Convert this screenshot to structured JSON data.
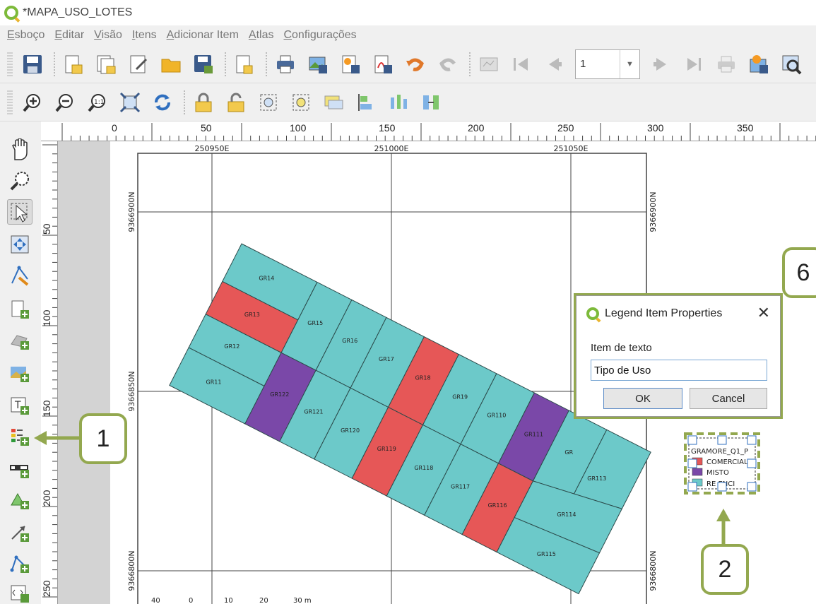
{
  "window": {
    "title": "*MAPA_USO_LOTES"
  },
  "menu": [
    "Esboço",
    "Editar",
    "Visão",
    "Itens",
    "Adicionar Item",
    "Atlas",
    "Configurações"
  ],
  "atlas": {
    "page": "1"
  },
  "ruler": {
    "h_labels": [
      "0",
      "50",
      "100",
      "150",
      "200",
      "250",
      "300",
      "350"
    ],
    "v_labels": [
      "50",
      "100",
      "150",
      "200",
      "250"
    ]
  },
  "map": {
    "grid_top_labels": [
      "250950E",
      "251000E",
      "251050E"
    ],
    "grid_side_labels": [
      "9366900N",
      "9366850N",
      "9366800N"
    ],
    "parcels": [
      {
        "label": "GR14",
        "use": "residencial"
      },
      {
        "label": "GR13",
        "use": "comercial"
      },
      {
        "label": "GR12",
        "use": "residencial"
      },
      {
        "label": "GR11",
        "use": "residencial"
      },
      {
        "label": "GR15",
        "use": "residencial"
      },
      {
        "label": "GR16",
        "use": "residencial"
      },
      {
        "label": "GR17",
        "use": "residencial"
      },
      {
        "label": "GR18",
        "use": "comercial"
      },
      {
        "label": "GR19",
        "use": "residencial"
      },
      {
        "label": "GR110",
        "use": "residencial"
      },
      {
        "label": "GR111",
        "use": "misto"
      },
      {
        "label": "GR122",
        "use": "misto"
      },
      {
        "label": "GR121",
        "use": "residencial"
      },
      {
        "label": "GR120",
        "use": "residencial"
      },
      {
        "label": "GR119",
        "use": "comercial"
      },
      {
        "label": "GR118",
        "use": "residencial"
      },
      {
        "label": "GR117",
        "use": "residencial"
      },
      {
        "label": "GR116",
        "use": "comercial"
      },
      {
        "label": "GR115",
        "use": "residencial"
      },
      {
        "label": "GR114",
        "use": "residencial"
      },
      {
        "label": "GR113",
        "use": "residencial"
      },
      {
        "label": "GR",
        "use": "residencial"
      }
    ],
    "colors": {
      "residencial": "#6cc9c9",
      "comercial": "#e65757",
      "misto": "#7a48a8"
    }
  },
  "legend": {
    "title": "GRAMORE_Q1_P",
    "items": [
      {
        "label": "COMERCIAL",
        "color": "#e65757"
      },
      {
        "label": "MISTO",
        "color": "#7a48a8"
      },
      {
        "label": "RE ENCI",
        "color": "#6cc9c9"
      }
    ]
  },
  "dialog": {
    "title": "Legend Item Properties",
    "field_label": "Item de texto",
    "field_value": "Tipo de Uso",
    "ok": "OK",
    "cancel": "Cancel"
  },
  "callouts": [
    "1",
    "2",
    "6"
  ],
  "scalebar": [
    "40",
    "0",
    "10",
    "20",
    "30 m"
  ],
  "accent": "#93a84f"
}
